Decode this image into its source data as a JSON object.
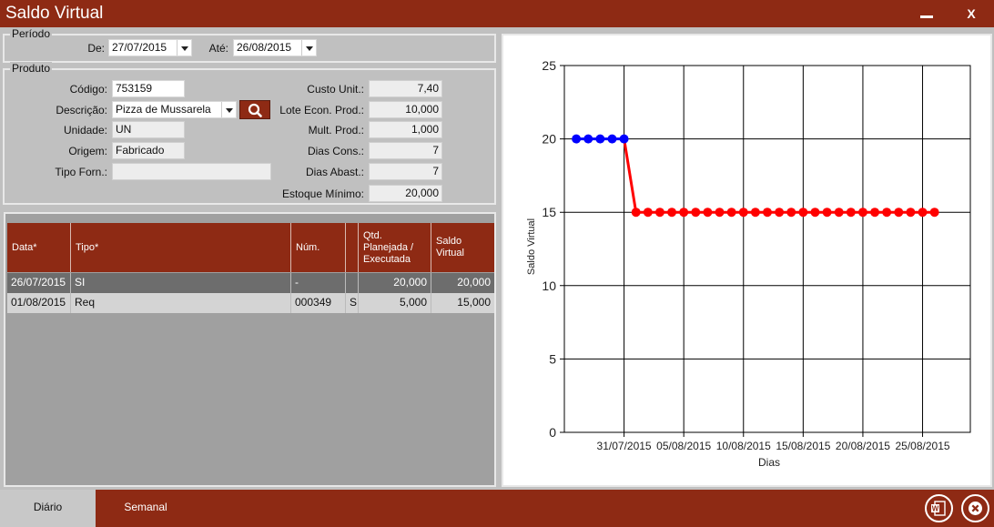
{
  "window": {
    "title": "Saldo Virtual",
    "close_label": "X"
  },
  "periodo": {
    "legend": "Período",
    "de_label": "De:",
    "de_value": "27/07/2015",
    "ate_label": "Até:",
    "ate_value": "26/08/2015"
  },
  "produto": {
    "legend": "Produto",
    "codigo_label": "Código:",
    "codigo_value": "753159",
    "descricao_label": "Descrição:",
    "descricao_value": "Pizza de Mussarela",
    "unidade_label": "Unidade:",
    "unidade_value": "UN",
    "origem_label": "Origem:",
    "origem_value": "Fabricado",
    "tipo_forn_label": "Tipo Forn.:",
    "tipo_forn_value": "",
    "custo_unit_label": "Custo Unit.:",
    "custo_unit_value": "7,40",
    "lote_econ_label": "Lote Econ. Prod.:",
    "lote_econ_value": "10,000",
    "mult_prod_label": "Mult. Prod.:",
    "mult_prod_value": "1,000",
    "dias_cons_label": "Dias Cons.:",
    "dias_cons_value": "7",
    "dias_abast_label": "Dias Abast.:",
    "dias_abast_value": "7",
    "estoque_min_label": "Estoque Mínimo:",
    "estoque_min_value": "20,000"
  },
  "table": {
    "headers": {
      "data": "Data*",
      "tipo": "Tipo*",
      "num": "Núm.",
      "flag": "",
      "qtd_1": "Qtd.",
      "qtd_2": "Planejada /",
      "qtd_3": "Executada",
      "saldo_1": "Saldo",
      "saldo_2": "Virtual"
    },
    "rows": [
      {
        "data": "26/07/2015",
        "tipo": "SI",
        "num": "-",
        "flag": "",
        "qtd": "20,000",
        "saldo": "20,000"
      },
      {
        "data": "01/08/2015",
        "tipo": "Req",
        "num": "000349",
        "flag": "S",
        "qtd": "5,000",
        "saldo": "15,000"
      }
    ]
  },
  "chart_data": {
    "type": "line",
    "xlabel": "Dias",
    "ylabel": "Saldo Virtual",
    "ylim": [
      0,
      25
    ],
    "yticks": [
      0,
      5,
      10,
      15,
      20,
      25
    ],
    "xlim": [
      "2015-07-26",
      "2015-08-29"
    ],
    "xticks": [
      "2015-07-31",
      "2015-08-05",
      "2015-08-10",
      "2015-08-15",
      "2015-08-20",
      "2015-08-25"
    ],
    "xtick_labels": [
      "31/07/2015",
      "05/08/2015",
      "10/08/2015",
      "15/08/2015",
      "20/08/2015",
      "25/08/2015"
    ],
    "grid": true,
    "series": [
      {
        "color": "#0000ff",
        "x": [
          "2015-07-27",
          "2015-07-28",
          "2015-07-29",
          "2015-07-30",
          "2015-07-31"
        ],
        "y": [
          20,
          20,
          20,
          20,
          20
        ]
      },
      {
        "color": "#ff0000",
        "x": [
          "2015-07-31",
          "2015-08-01",
          "2015-08-02",
          "2015-08-03",
          "2015-08-04",
          "2015-08-05",
          "2015-08-06",
          "2015-08-07",
          "2015-08-08",
          "2015-08-09",
          "2015-08-10",
          "2015-08-11",
          "2015-08-12",
          "2015-08-13",
          "2015-08-14",
          "2015-08-15",
          "2015-08-16",
          "2015-08-17",
          "2015-08-18",
          "2015-08-19",
          "2015-08-20",
          "2015-08-21",
          "2015-08-22",
          "2015-08-23",
          "2015-08-24",
          "2015-08-25",
          "2015-08-26"
        ],
        "y": [
          20,
          15,
          15,
          15,
          15,
          15,
          15,
          15,
          15,
          15,
          15,
          15,
          15,
          15,
          15,
          15,
          15,
          15,
          15,
          15,
          15,
          15,
          15,
          15,
          15,
          15,
          15
        ],
        "markers_from_index": 1
      }
    ]
  },
  "tabs": {
    "diario": "Diário",
    "semanal": "Semanal"
  },
  "colors": {
    "brand": "#8e2a14",
    "row_selected": "#6d6d6d",
    "row_normal": "#d4d4d4"
  },
  "icons": {
    "search": "search-icon",
    "word": "word-icon",
    "close": "close-circle-icon"
  }
}
